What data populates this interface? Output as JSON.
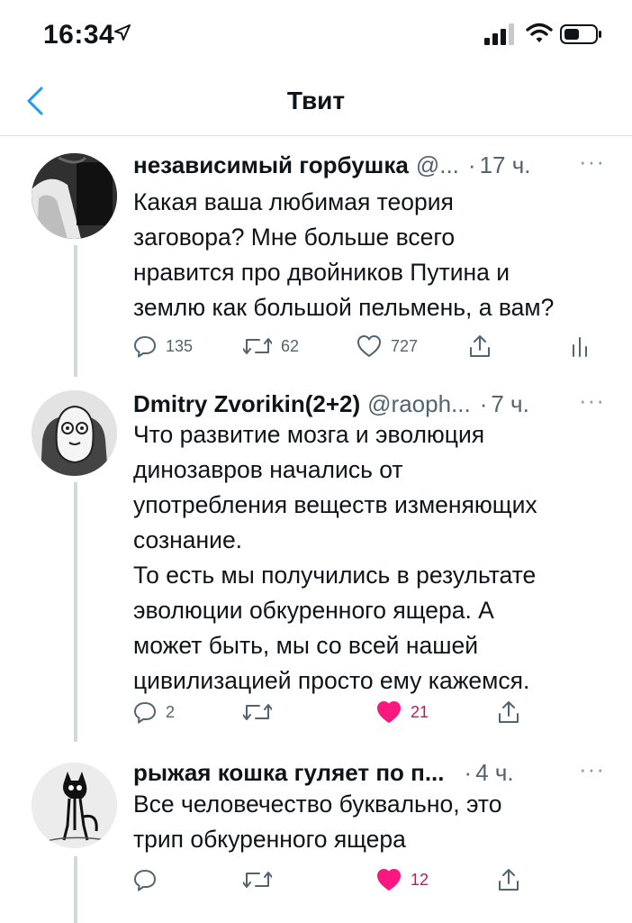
{
  "status_bar": {
    "time": "16:34"
  },
  "nav": {
    "title": "Твит"
  },
  "tweets": [
    {
      "user": "независимый горбушка",
      "handle": "@...",
      "time_ago": "17 ч.",
      "more": "···",
      "text_lines": [
        "Какая ваша любимая теория",
        "заговора? Мне больше всего",
        "нравится про двойников Путина и",
        "землю как большой пельмень, а вам?"
      ],
      "replies": "135",
      "retweets": "62",
      "likes": "727",
      "liked": false
    },
    {
      "user": "Dmitry Zvorikin(2+2)",
      "handle": "@raoph...",
      "time_ago": "7 ч.",
      "more": "···",
      "text_lines": [
        "Что развитие мозга и эволюция",
        "динозавров начались от",
        "употребления веществ изменяющих",
        "сознание.",
        "То есть мы получились в результате",
        "эволюции обкуренного ящера. А",
        "может быть, мы со всей нашей",
        "цивилизацией просто ему кажемся."
      ],
      "replies": "2",
      "retweets": "",
      "likes": "21",
      "liked": true
    },
    {
      "user": "рыжая кошка гуляет по п...",
      "handle": "",
      "time_ago": "4 ч.",
      "more": "···",
      "text_lines": [
        "Все человечество буквально, это",
        "трип обкуренного ящера"
      ],
      "replies": "",
      "retweets": "",
      "likes": "12",
      "liked": true
    }
  ],
  "colors": {
    "accent": "#1d9bf0",
    "like": "#f91880",
    "muted": "#536471",
    "text": "#0f1419"
  }
}
